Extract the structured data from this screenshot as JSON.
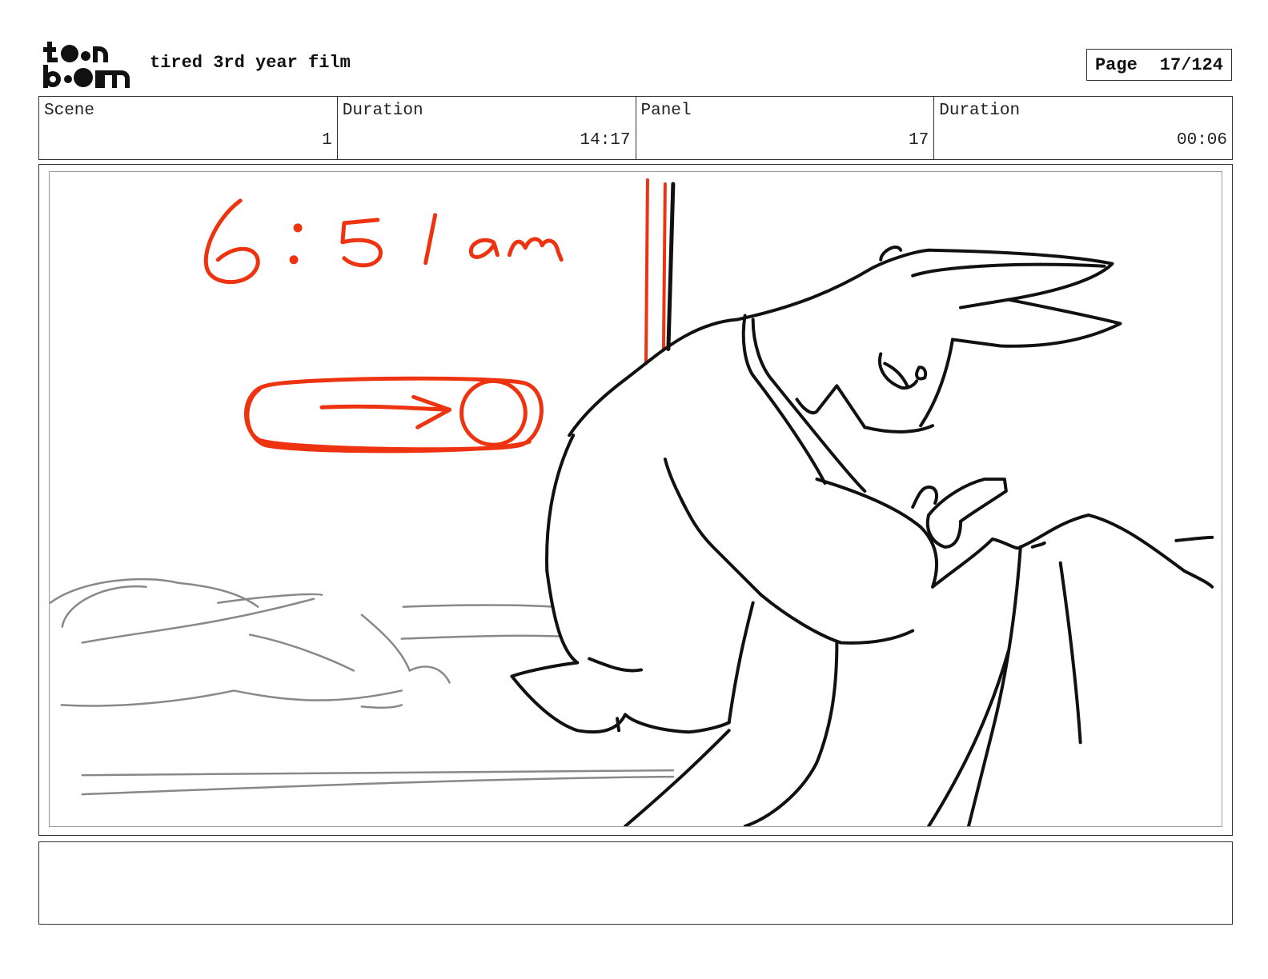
{
  "header": {
    "logo_top": "toon",
    "logo_bottom": "boom",
    "title": "tired 3rd year film",
    "page_label": "Page",
    "page_value": "17/124"
  },
  "info": [
    {
      "label": "Scene",
      "value": "1"
    },
    {
      "label": "Duration",
      "value": "14:17"
    },
    {
      "label": "Panel",
      "value": "17"
    },
    {
      "label": "Duration",
      "value": "00:06"
    }
  ],
  "sketch": {
    "time_annotation": "6:51am",
    "annotation_color": "#ee3311",
    "line_color": "#111111",
    "background_line_color": "#888888"
  },
  "notes": ""
}
